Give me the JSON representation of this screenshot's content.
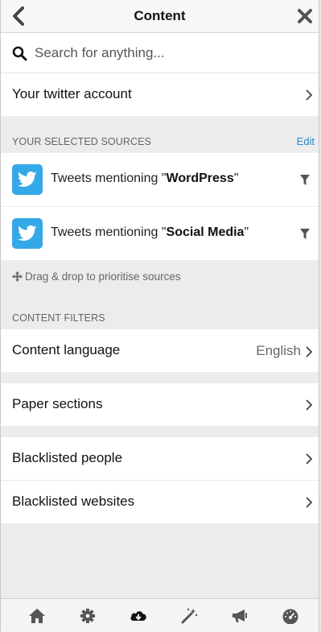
{
  "header": {
    "title": "Content"
  },
  "search": {
    "placeholder": "Search for anything..."
  },
  "account": {
    "label": "Your twitter account"
  },
  "sources": {
    "section_label": "YOUR SELECTED SOURCES",
    "edit_label": "Edit",
    "items": [
      {
        "prefix": "Tweets mentioning \"",
        "keyword": "WordPress",
        "suffix": "\"",
        "icon": "twitter-icon"
      },
      {
        "prefix": "Tweets mentioning \"",
        "keyword": "Social Media",
        "suffix": "\"",
        "icon": "twitter-icon"
      }
    ],
    "hint": "Drag & drop to prioritise sources"
  },
  "filters": {
    "section_label": "CONTENT FILTERS",
    "language_label": "Content language",
    "language_value": "English",
    "paper_sections_label": "Paper sections",
    "blacklisted_people_label": "Blacklisted people",
    "blacklisted_websites_label": "Blacklisted websites"
  },
  "tabbar": {
    "items": [
      {
        "icon": "home-icon"
      },
      {
        "icon": "gear-icon"
      },
      {
        "icon": "cloud-download-icon",
        "active": true
      },
      {
        "icon": "magic-wand-icon"
      },
      {
        "icon": "megaphone-icon"
      },
      {
        "icon": "dashboard-icon"
      }
    ]
  },
  "colors": {
    "accent": "#2a88c9",
    "twitter": "#34a8e8",
    "background": "#ececed"
  }
}
